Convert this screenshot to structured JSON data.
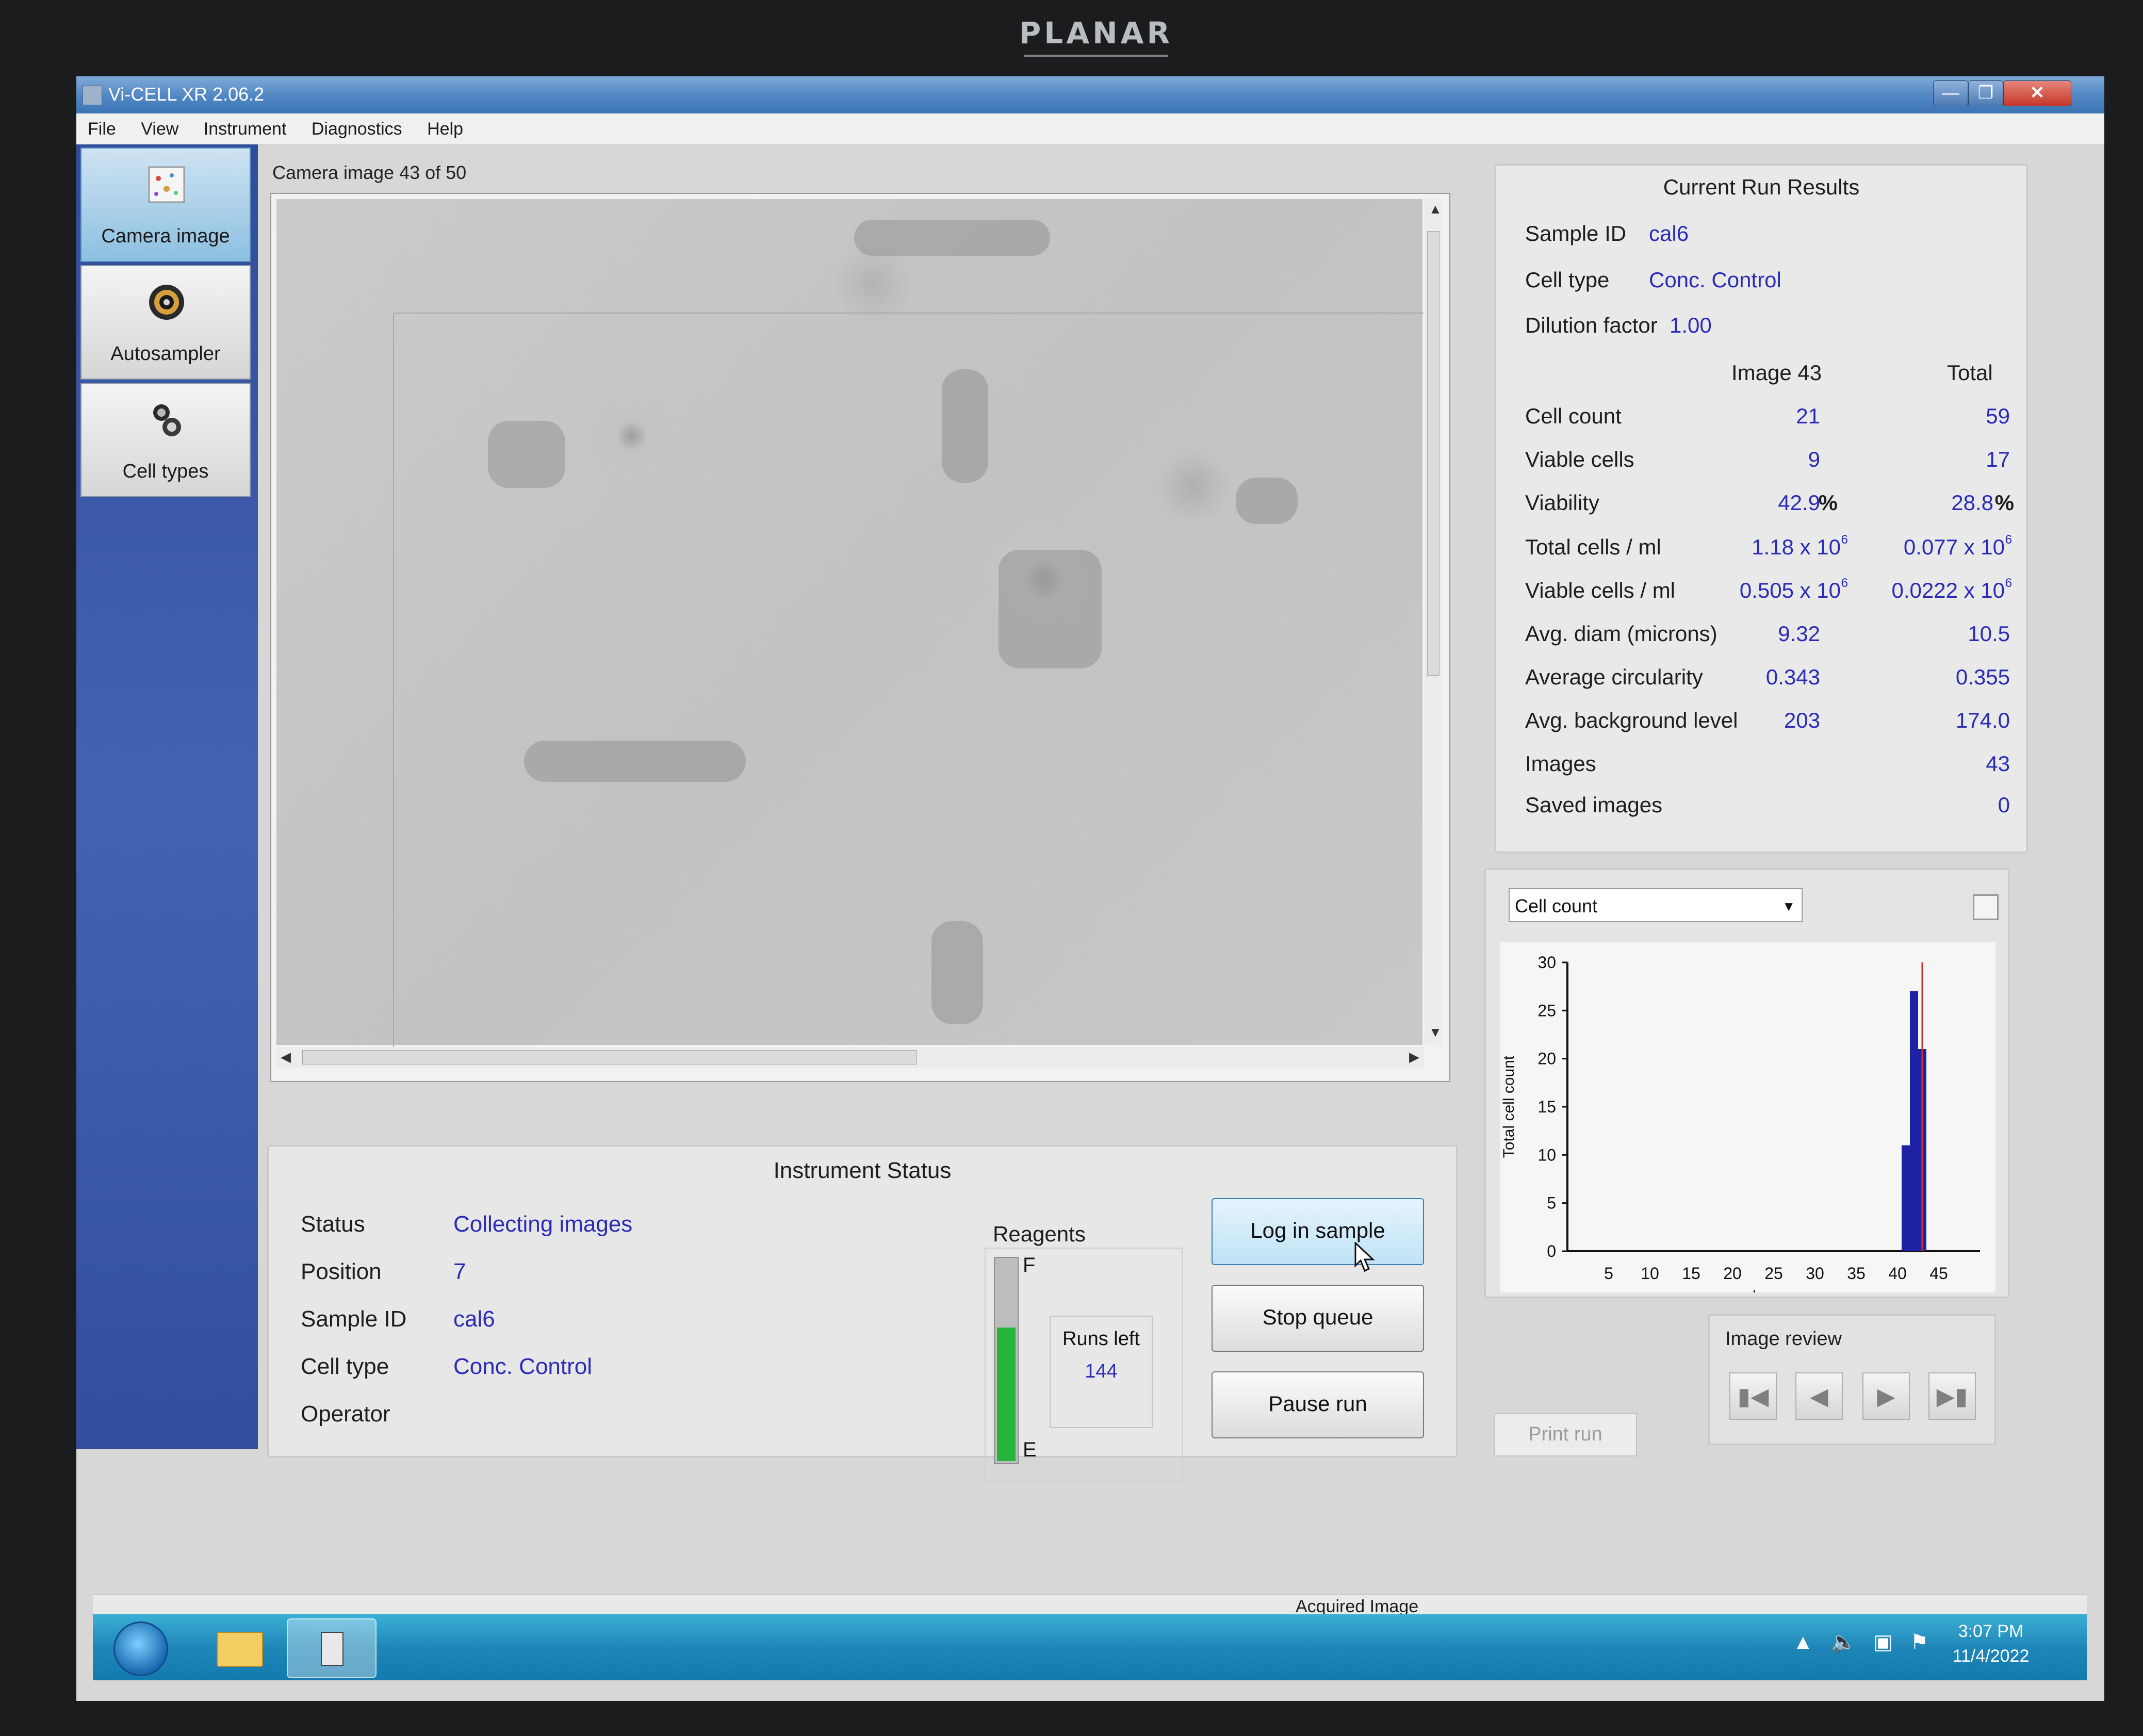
{
  "monitor": {
    "brand": "PLANAR"
  },
  "window": {
    "title": "Vi-CELL XR 2.06.2"
  },
  "menu": [
    "File",
    "View",
    "Instrument",
    "Diagnostics",
    "Help"
  ],
  "nav": {
    "camera": "Camera image",
    "autosampler": "Autosampler",
    "cell_types": "Cell types"
  },
  "camera": {
    "title": "Camera image 43 of 50"
  },
  "results": {
    "heading": "Current Run Results",
    "sample_id_label": "Sample ID",
    "sample_id": "cal6",
    "cell_type_label": "Cell type",
    "cell_type": "Conc. Control",
    "dilution_label": "Dilution factor",
    "dilution": "1.00",
    "col_image": "Image 43",
    "col_total": "Total",
    "rows": [
      {
        "label": "Cell count",
        "image": "21",
        "total": "59",
        "unit": ""
      },
      {
        "label": "Viable cells",
        "image": "9",
        "total": "17",
        "unit": ""
      },
      {
        "label": "Viability",
        "image": "42.9",
        "total": "28.8",
        "unit": "%"
      },
      {
        "label": "Total cells / ml",
        "image": "1.18 x 10",
        "total": "0.077 x 10",
        "unit": "6"
      },
      {
        "label": "Viable cells / ml",
        "image": "0.505 x 10",
        "total": "0.0222 x 10",
        "unit": "6"
      },
      {
        "label": "Avg. diam (microns)",
        "image": "9.32",
        "total": "10.5",
        "unit": ""
      },
      {
        "label": "Average circularity",
        "image": "0.343",
        "total": "0.355",
        "unit": ""
      },
      {
        "label": "Avg. background level",
        "image": "203",
        "total": "174.0",
        "unit": ""
      },
      {
        "label": "Images",
        "image": "",
        "total": "43",
        "unit": ""
      },
      {
        "label": "Saved images",
        "image": "",
        "total": "0",
        "unit": ""
      }
    ]
  },
  "chart_panel": {
    "dropdown": "Cell count"
  },
  "chart_data": {
    "type": "bar",
    "xlabel": "Image",
    "ylabel": "Total cell count",
    "xlim": [
      0,
      50
    ],
    "ylim": [
      0,
      30
    ],
    "xticks": [
      5,
      10,
      15,
      20,
      25,
      30,
      35,
      40,
      45
    ],
    "yticks": [
      0,
      5,
      10,
      15,
      20,
      25,
      30
    ],
    "x": [
      41,
      42,
      43
    ],
    "values": [
      11,
      27,
      21
    ],
    "marker_x": 43,
    "bar_color": "#1c22a3",
    "marker_color": "#d0302a"
  },
  "status": {
    "heading": "Instrument Status",
    "status_label": "Status",
    "status_value": "Collecting images",
    "position_label": "Position",
    "position_value": "7",
    "sample_label": "Sample ID",
    "sample_value": "cal6",
    "celltype_label": "Cell type",
    "celltype_value": "Conc. Control",
    "operator_label": "Operator",
    "operator_value": ""
  },
  "reagents": {
    "title": "Reagents",
    "full": "F",
    "empty": "E",
    "level": 0.65,
    "runs_left_label": "Runs left",
    "runs_left": "144"
  },
  "buttons": {
    "log_in": "Log in sample",
    "stop_queue": "Stop queue",
    "pause_run": "Pause run",
    "print_run": "Print run"
  },
  "review": {
    "title": "Image review"
  },
  "statusbar": {
    "text": "Acquired Image"
  },
  "taskbar": {
    "time": "3:07 PM",
    "date": "11/4/2022"
  }
}
